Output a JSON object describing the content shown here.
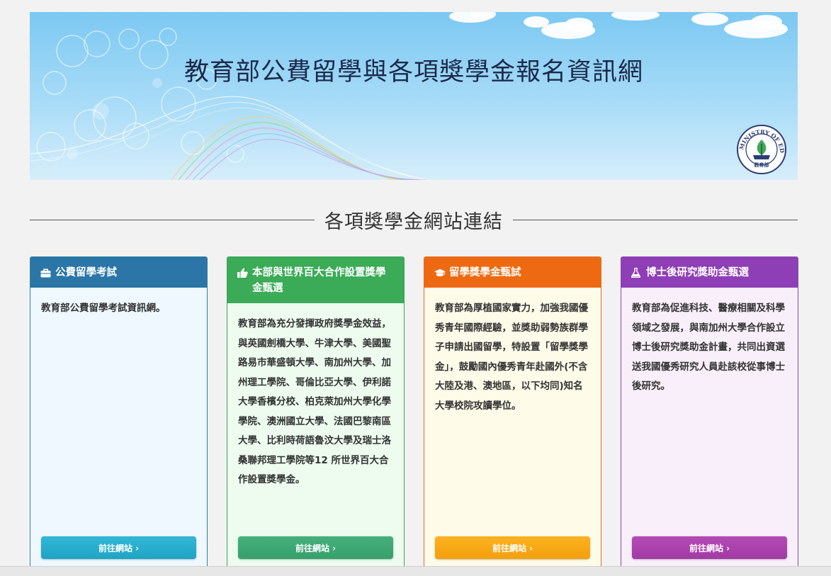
{
  "banner": {
    "title": "教育部公費留學與各項獎學金報名資訊網",
    "seal_text": "MINISTRY OF EDUCATION",
    "seal_sub": "教育部"
  },
  "section": {
    "heading": "各項獎學金網站連結"
  },
  "cards": [
    {
      "title": "公費留學考試",
      "icon": "briefcase-icon",
      "body": "教育部公費留學考試資訊網。",
      "button": "前往網站 ›",
      "color": "#2b76a6"
    },
    {
      "title": "本部與世界百大合作設置獎學金甄選",
      "icon": "thumbs-up-icon",
      "body": "教育部為充分發揮政府獎學金效益，與英國劍橋大學、牛津大學、美國聖路易市華盛頓大學、南加州大學、加州理工學院、哥倫比亞大學、伊利諾大學香檳分校、柏克萊加州大學化學學院、澳洲國立大學、法國巴黎南區大學、比利時荷語魯汶大學及瑞士洛桑聯邦理工學院等12 所世界百大合作設置獎學金。",
      "button": "前往網站 ›",
      "color": "#3bab57"
    },
    {
      "title": "留學獎學金甄試",
      "icon": "graduation-cap-icon",
      "body": "教育部為厚植國家實力，加強我國優秀青年國際經驗，並獎助弱勢族群學子申請出國留學，特設置「留學獎學金」，鼓勵國內優秀青年赴國外(不含大陸及港、澳地區，以下均同)知名大學校院攻讀學位。",
      "button": "前往網站 ›",
      "color": "#ee6a12"
    },
    {
      "title": "博士後研究獎助金甄選",
      "icon": "flask-icon",
      "body": "教育部為促進科技、醫療相關及科學領域之發展，與南加州大學合作設立博士後研究獎助金計畫，共同出資選送我國優秀研究人員赴該校從事博士後研究。",
      "button": "前往網站 ›",
      "color": "#8e3fb5"
    }
  ]
}
